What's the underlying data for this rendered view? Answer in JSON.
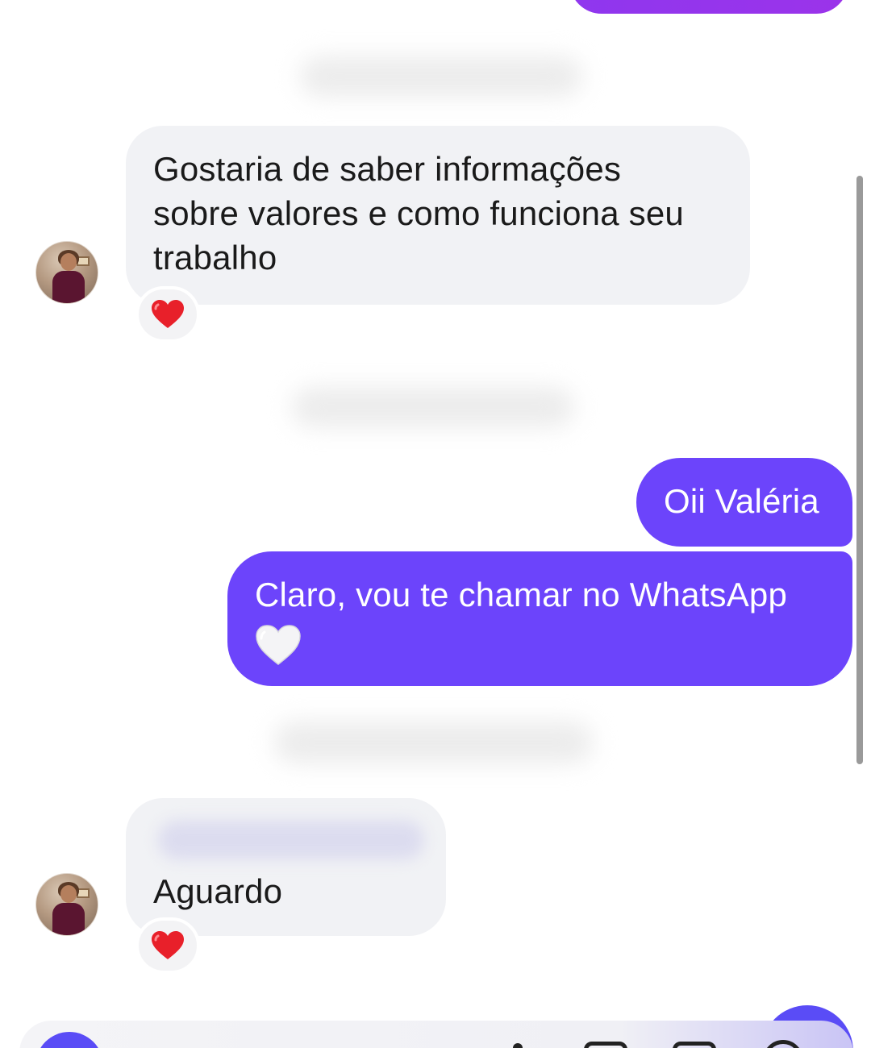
{
  "messages": [
    {
      "direction": "incoming",
      "text": "Gostaria de saber informações sobre valores e como funciona seu trabalho",
      "lines": [
        "Gostaria de saber informações",
        "sobre valores e como funciona seu",
        "trabalho"
      ],
      "reaction": "❤️"
    },
    {
      "direction": "outgoing",
      "text": "Oii Valéria"
    },
    {
      "direction": "outgoing",
      "text": "Claro, vou te chamar no WhatsApp",
      "trailing_emoji": "white-heart"
    },
    {
      "direction": "incoming",
      "text": "Aguardo",
      "reaction": "❤️"
    }
  ],
  "colors": {
    "outgoing_bubble": "#6c44fb",
    "incoming_bubble": "#f1f2f5",
    "top_bubble_gradient": "#9b33ea",
    "heart": "#e8202a"
  },
  "icons": {
    "reaction": "red-heart-icon",
    "emoji_in_message": "white-heart-icon",
    "avatar": "contact-avatar"
  }
}
